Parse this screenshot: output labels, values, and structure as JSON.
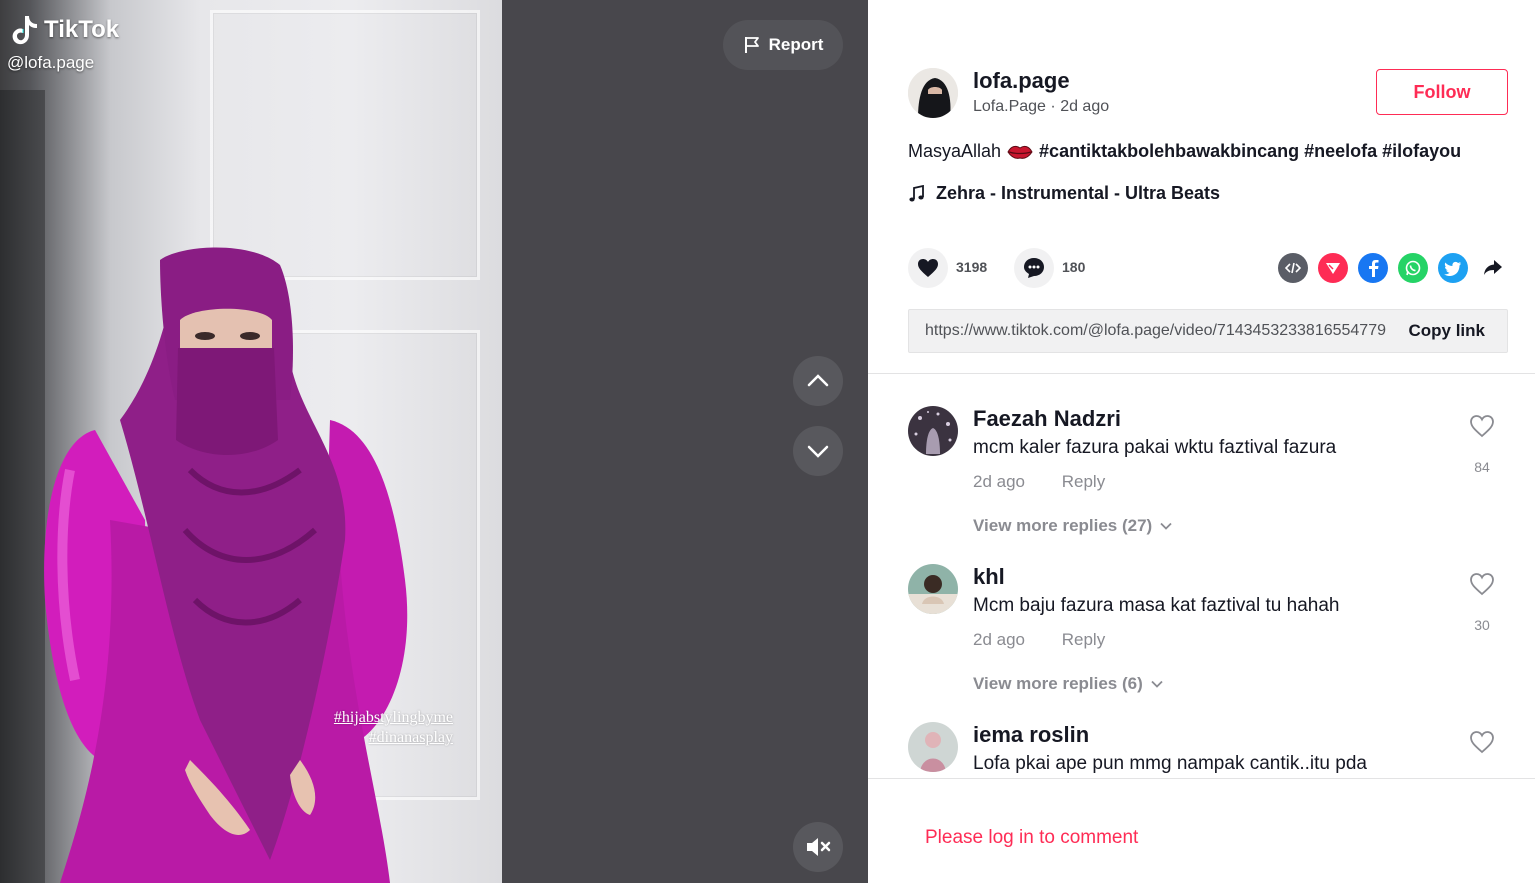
{
  "app": {
    "brand": "TikTok",
    "accent_color": "#fe2c55"
  },
  "video": {
    "watermark_handle": "@lofa.page",
    "overlay_tags": [
      "#hijabstylingbyme",
      "#dinanasplay"
    ],
    "report_label": "Report",
    "nav_up_icon": "chevron-up-icon",
    "nav_down_icon": "chevron-down-icon",
    "mute_icon": "muted-speaker-icon"
  },
  "author": {
    "username": "lofa.page",
    "nickname": "Lofa.Page",
    "posted": "2d ago",
    "follow_label": "Follow"
  },
  "post": {
    "caption_text": "MasyaAllah",
    "caption_emoji": "lips",
    "caption_tags": "#cantiktakbolehbawakbincang #neelofa #ilofayou",
    "music": "Zehra - Instrumental - Ultra Beats"
  },
  "stats": {
    "likes": "3198",
    "comments": "180"
  },
  "share_icons": [
    "embed-icon",
    "send-icon",
    "facebook-icon",
    "whatsapp-icon",
    "twitter-icon",
    "share-arrow-icon"
  ],
  "link": {
    "url": "https://www.tiktok.com/@lofa.page/video/7143453233816554779",
    "copy_label": "Copy link"
  },
  "comments": [
    {
      "name": "Faezah Nadzri",
      "text": "mcm kaler fazura pakai wktu faztival fazura",
      "time": "2d ago",
      "reply": "Reply",
      "likes": "84",
      "more": "View more replies (27)"
    },
    {
      "name": "khl",
      "text": "Mcm baju fazura masa kat faztival tu hahah",
      "time": "2d ago",
      "reply": "Reply",
      "likes": "30",
      "more": "View more replies (6)"
    },
    {
      "name": "iema roslin",
      "text": "Lofa pkai ape pun mmg nampak cantik..itu pda"
    }
  ],
  "login_prompt": "Please log in to comment"
}
